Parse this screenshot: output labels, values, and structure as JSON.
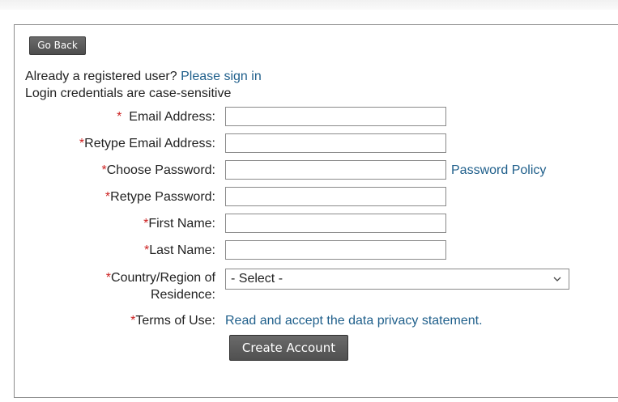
{
  "nav": {
    "go_back_label": "Go Back"
  },
  "intro": {
    "registered_prompt": "Already a registered user?",
    "sign_in_link": "Please sign in",
    "case_note": "Login credentials are case-sensitive"
  },
  "form": {
    "required_marker": "*",
    "email_label": "Email Address:",
    "email_value": "",
    "retype_email_label": "Retype Email Address:",
    "retype_email_value": "",
    "password_label": "Choose Password:",
    "password_value": "",
    "password_policy_link": "Password Policy",
    "retype_password_label": "Retype Password:",
    "retype_password_value": "",
    "first_name_label": "First Name:",
    "first_name_value": "",
    "last_name_label": "Last Name:",
    "last_name_value": "",
    "country_label_line1": "Country/Region of",
    "country_label_line2": "Residence:",
    "country_selected": "- Select -",
    "terms_label": "Terms of Use:",
    "terms_link": "Read and accept the data privacy statement.",
    "create_account_label": "Create Account"
  },
  "icons": {
    "dropdown": "chevron-down-icon"
  },
  "colors": {
    "link": "#1f5f8b",
    "required": "#cc2020",
    "button": "#5a5a5a"
  }
}
